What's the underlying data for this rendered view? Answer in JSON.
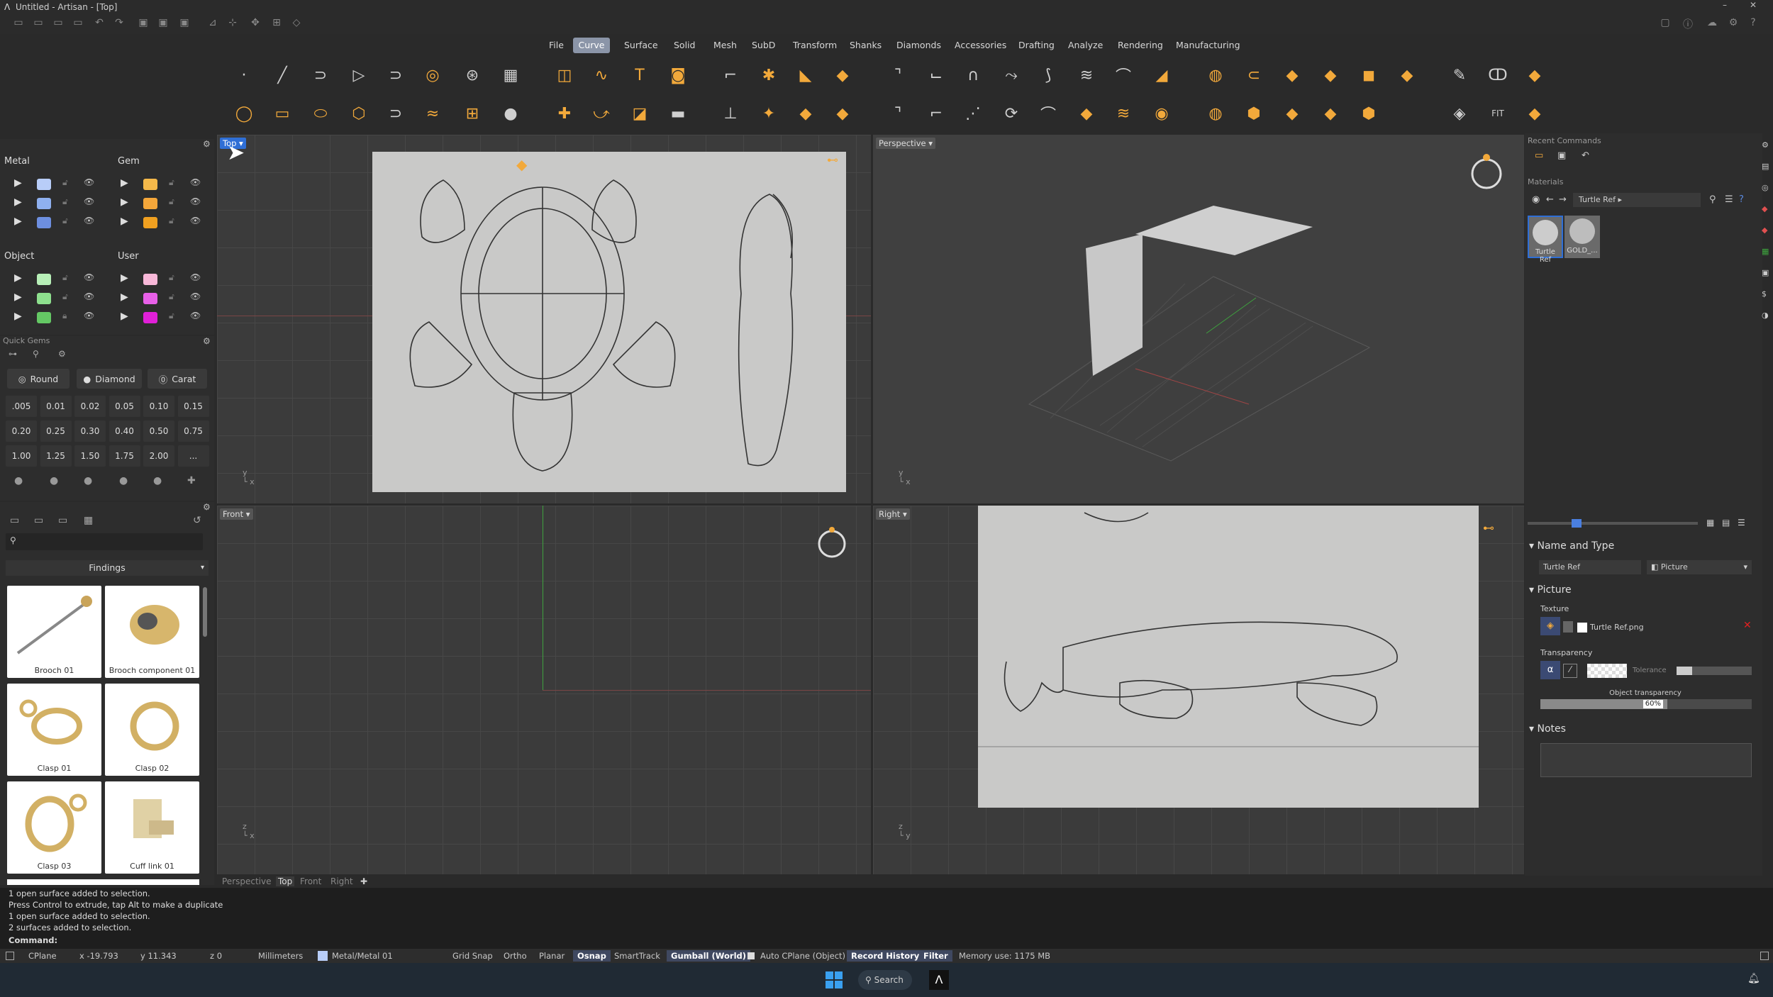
{
  "window": {
    "title": "Untitled - Artisan - [Top]"
  },
  "menus": [
    "File",
    "Curve",
    "Surface",
    "Solid",
    "Mesh",
    "SubD",
    "Transform",
    "Shanks",
    "Diamonds",
    "Accessories",
    "Drafting",
    "Analyze",
    "Rendering",
    "Manufacturing"
  ],
  "active_menu": "Curve",
  "layers": {
    "metal": "Metal",
    "gem": "Gem",
    "object": "Object",
    "user": "User"
  },
  "quick_gems": {
    "header": "Quick Gems",
    "shape_round": "Round",
    "shape_diamond": "Diamond",
    "unit_carat": "Carat",
    "sizes": [
      ".005",
      "0.01",
      "0.02",
      "0.05",
      "0.10",
      "0.15",
      "0.20",
      "0.25",
      "0.30",
      "0.40",
      "0.50",
      "0.75",
      "1.00",
      "1.25",
      "1.50",
      "1.75",
      "2.00",
      "..."
    ]
  },
  "library": {
    "category": "Findings",
    "items": [
      "Brooch 01",
      "Brooch component 01",
      "Clasp 01",
      "Clasp 02",
      "Clasp 03",
      "Cuff link 01"
    ]
  },
  "viewports": {
    "top": "Top",
    "perspective": "Perspective",
    "front": "Front",
    "right": "Right"
  },
  "viewport_tabs": [
    "Perspective",
    "Top",
    "Front",
    "Right"
  ],
  "active_viewport_tab": "Top",
  "right_panel": {
    "recent_commands": "Recent Commands",
    "materials": "Materials",
    "breadcrumb": "Turtle Ref",
    "material_thumbs": [
      "Turtle Ref",
      "GOLD_..."
    ],
    "name_and_type": "Name and Type",
    "name_value": "Turtle Ref",
    "type_value": "Picture",
    "picture": "Picture",
    "texture": "Texture",
    "texture_file": "Turtle Ref.png",
    "transparency": "Transparency",
    "tolerance": "Tolerance",
    "object_transparency": "Object transparency",
    "object_transparency_value": "60%",
    "object_transparency_fraction": 0.6,
    "notes": "Notes"
  },
  "command_history": [
    "1 open surface added to selection.",
    "Press Control to extrude, tap Alt to make a duplicate",
    "1 open surface added to selection.",
    "2 surfaces added to selection."
  ],
  "command_prompt": "Command:",
  "status": {
    "cplane": "CPlane",
    "x": "x -19.793",
    "y": "y 11.343",
    "z": "z 0",
    "units": "Millimeters",
    "layer": "Metal/Metal 01",
    "grid_snap": "Grid Snap",
    "ortho": "Ortho",
    "planar": "Planar",
    "osnap": "Osnap",
    "smarttrack": "SmartTrack",
    "gumball": "Gumball (World)",
    "auto_cplane": "Auto CPlane (Object)",
    "record_history": "Record History",
    "filter": "Filter",
    "memory": "Memory use: 1175 MB"
  },
  "taskbar": {
    "search": "Search"
  },
  "colors": {
    "accent": "#2f6fd6",
    "orange": "#f2a93b",
    "active_menu": "#8b95a8"
  }
}
